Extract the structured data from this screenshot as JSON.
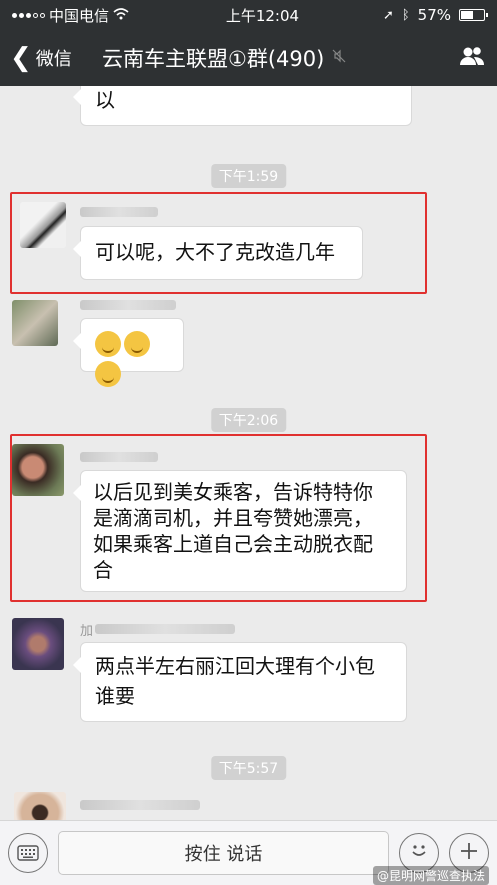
{
  "status_bar": {
    "carrier": "中国电信",
    "time": "上午12:04",
    "battery": "57%",
    "battery_level": 0.57
  },
  "nav": {
    "back_label": "微信",
    "title": "云南车主联盟①群(490)"
  },
  "messages": [
    {
      "text": "以"
    },
    {
      "time": "下午1:59"
    },
    {
      "text": "可以呢，大不了克改造几年"
    },
    {
      "text": "🤔🤔🤔",
      "emoji_count": 3
    },
    {
      "time": "下午2:06"
    },
    {
      "text": "以后见到美女乘客，告诉特特你是滴滴司机，并且夸赞她漂亮，如果乘客上道自己会主动脱衣配合",
      "lines": [
        "以后见到美女乘客，告诉特特你",
        "是滴滴司机，并且夸赞她漂亮，",
        "如果乘客上道自己会主动脱衣配",
        "合"
      ]
    },
    {
      "nick": "加",
      "text": "两点半左右丽江回大理有个小包谁要",
      "lines": [
        "两点半左右丽江回大理有个小包",
        "谁要"
      ]
    },
    {
      "time": "下午5:57"
    }
  ],
  "bottom_bar": {
    "hold_label": "按住 说话"
  },
  "watermark": "@昆明网警巡查执法",
  "colors": {
    "highlight": "#e0302f",
    "bar": "#2e3133",
    "chat_bg": "#ebebeb"
  }
}
